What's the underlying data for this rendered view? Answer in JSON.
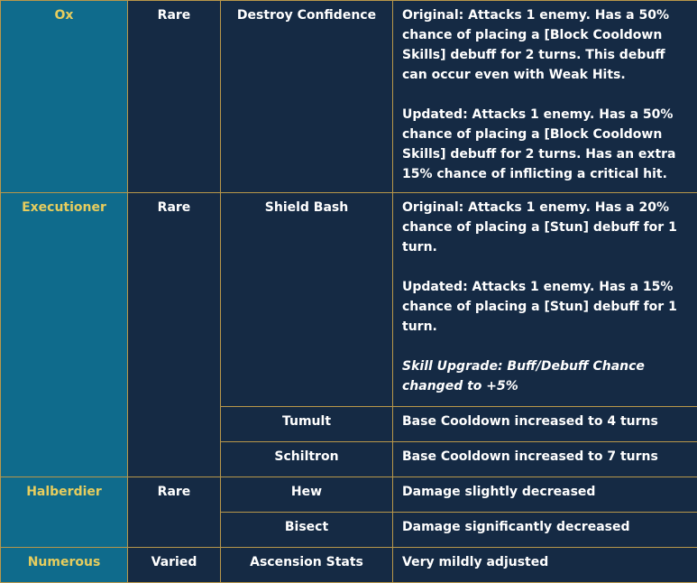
{
  "rows": {
    "ox": {
      "champion": "Ox",
      "rarity": "Rare",
      "skill": "Destroy Confidence",
      "original_label": "Original:",
      "original_text": " Attacks 1 enemy. Has a 50% chance of placing a [Block Cooldown Skills] debuff for 2 turns. This debuff can occur even with Weak Hits.",
      "updated_label": "Updated:",
      "updated_text": " Attacks 1 enemy. Has a 50% chance of placing a [Block Cooldown Skills] debuff for 2 turns. Has an extra 15% chance of inflicting a critical hit."
    },
    "executioner": {
      "champion": "Executioner",
      "rarity": "Rare",
      "skills": [
        {
          "name": "Shield Bash",
          "original_label": "Original:",
          "original_text": " Attacks 1 enemy. Has a 20% chance of placing a [Stun] debuff for 1 turn.",
          "updated_label": "Updated:",
          "updated_text": " Attacks 1 enemy. Has a 15% chance of placing a [Stun] debuff for 1 turn.",
          "note": "Skill Upgrade: Buff/Debuff Chance changed to +5%"
        },
        {
          "name": "Tumult",
          "change": "Base Cooldown increased to 4 turns"
        },
        {
          "name": "Schiltron",
          "change": "Base Cooldown increased to 7 turns"
        }
      ]
    },
    "halberdier": {
      "champion": "Halberdier",
      "rarity": "Rare",
      "skills": [
        {
          "name": "Hew",
          "change": "Damage slightly decreased"
        },
        {
          "name": "Bisect",
          "change": "Damage significantly decreased"
        }
      ]
    },
    "numerous": {
      "champion": "Numerous",
      "rarity": "Varied",
      "skill": "Ascension Stats",
      "change": "Very mildly adjusted"
    }
  },
  "colors": {
    "background": "#152a44",
    "champion_cell": "#0f6b8c",
    "champion_text": "#e6cd5e",
    "border": "#b8974a",
    "text": "#ffffff"
  }
}
